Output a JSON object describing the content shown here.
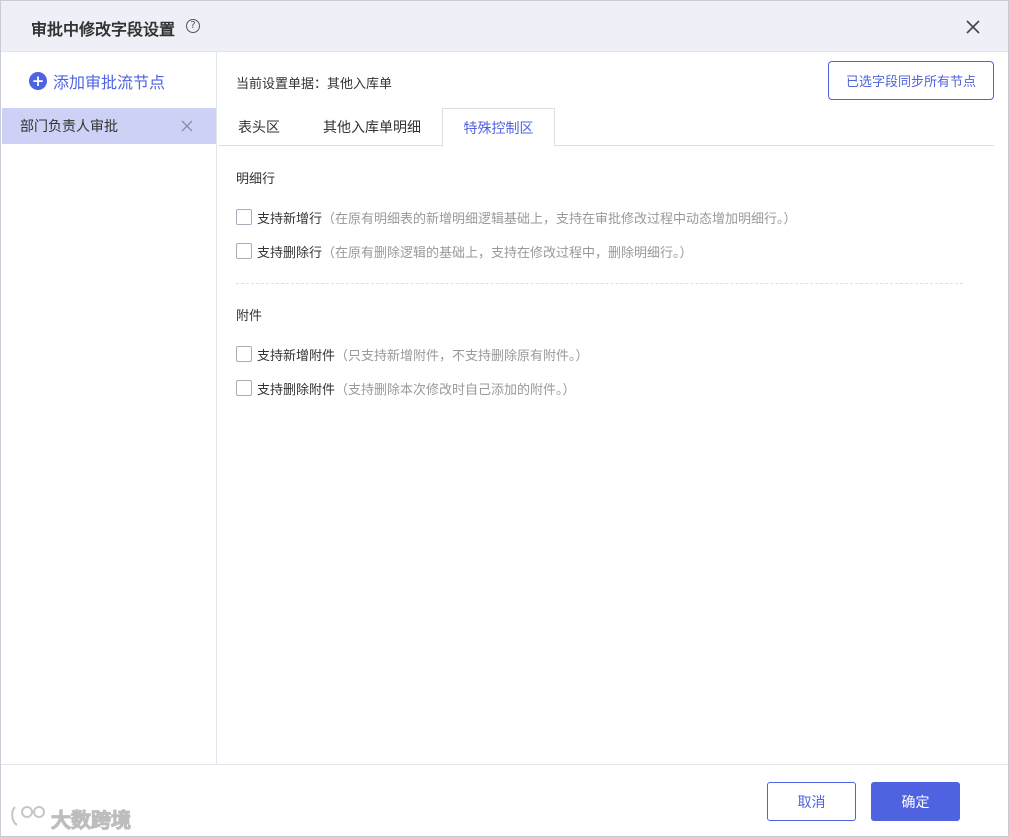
{
  "dialog": {
    "title": "审批中修改字段设置",
    "help_icon": "question-circle-icon",
    "help_glyph": "?",
    "close_icon": "close-icon"
  },
  "sidebar": {
    "add_node_label": "添加审批流节点",
    "add_icon": "plus-circle-icon",
    "add_glyph": "+",
    "nodes": [
      {
        "label": "部门负责人审批",
        "remove_icon": "close-icon"
      }
    ]
  },
  "main": {
    "current_doc": "当前设置单据：其他入库单",
    "sync_button": "已选字段同步所有节点",
    "tabs": [
      {
        "label": "表头区",
        "active": false
      },
      {
        "label": "其他入库单明细",
        "active": false
      },
      {
        "label": "特殊控制区",
        "active": true
      }
    ],
    "sections": [
      {
        "title": "明细行",
        "options": [
          {
            "label": "支持新增行",
            "hint": "（在原有明细表的新增明细逻辑基础上，支持在审批修改过程中动态增加明细行。）",
            "checked": false
          },
          {
            "label": "支持删除行",
            "hint": "（在原有删除逻辑的基础上，支持在修改过程中，删除明细行。）",
            "checked": false
          }
        ]
      },
      {
        "title": "附件",
        "options": [
          {
            "label": "支持新增附件",
            "hint": "（只支持新增附件，不支持删除原有附件。）",
            "checked": false
          },
          {
            "label": "支持删除附件",
            "hint": "（支持删除本次修改时自己添加的附件。）",
            "checked": false
          }
        ]
      }
    ]
  },
  "footer": {
    "cancel_label": "取消",
    "ok_label": "确定"
  },
  "watermark": {
    "text": "大数跨境",
    "icon": "logo-icon"
  },
  "colors": {
    "accent": "#4f63e0",
    "selected_node_bg": "#ccd1f5",
    "header_bg": "#eef0f7",
    "hint_text": "#999999"
  }
}
